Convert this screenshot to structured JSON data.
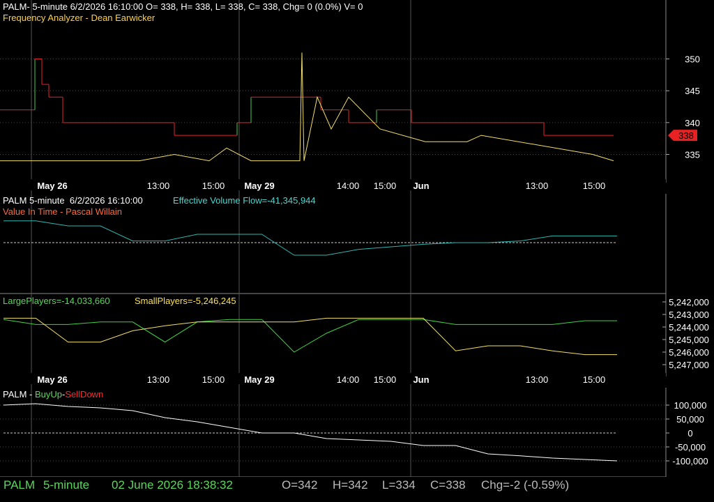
{
  "colors": {
    "green": "#43d143",
    "red": "#e82222",
    "yellow": "#f5e06a",
    "cyan": "#2fb7b0",
    "white": "#ffffff",
    "grid": "#4a4a4a",
    "orange": "#ff6a3d"
  },
  "panel1": {
    "header": "PALM- 5-minute 6/2/2026 16:10:00 O= 338, H= 338, L= 338, C= 338, Chg= 0 (0.0%) V= 0",
    "indicator": "Frequency Analyzer - Dean Earwicker",
    "last_price_tag": "338"
  },
  "panel2": {
    "header": "PALM 5-minute  6/2/2026 16:10:00",
    "flow_label": "Effective Volume Flow=-41,345,944",
    "indicator": "Value In Time - Pascal Willain"
  },
  "panel3": {
    "large_label": "LargePlayers=-14,033,660",
    "small_label": "SmallPlayers=-5,246,245"
  },
  "panel4": {
    "title_prefix": "PALM - ",
    "buy_label": "BuyUp",
    "sep": "-",
    "sell_label": "SellDown"
  },
  "status": {
    "symbol": "PALM",
    "interval": "5-minute",
    "datetime": "02 June 2026 18:38:32",
    "open": "O=342",
    "high": "H=342",
    "low": "L=334",
    "close": "C=338",
    "change": "Chg=-2 (-0.59%)"
  },
  "chart_data": [
    {
      "type": "line",
      "title": "Frequency Analyzer - Dean Earwicker",
      "x_ticks": [
        "May 26",
        "13:00",
        "15:00",
        "May 29",
        "14:00",
        "15:00",
        "Jun",
        "13:00",
        "15:00"
      ],
      "y_ticks": [
        335,
        340,
        345,
        350
      ],
      "ylim": [
        331,
        354
      ],
      "grid": true,
      "series": [
        {
          "color": "red_green",
          "x": [
            0,
            30,
            50,
            60,
            70,
            90,
            120,
            160,
            200,
            250,
            300,
            340,
            360,
            420,
            460,
            500,
            540,
            590,
            640,
            700,
            780,
            880
          ],
          "values": [
            342,
            342,
            350,
            346,
            344,
            340,
            340,
            340,
            340,
            338,
            338,
            340,
            344,
            344,
            342,
            340,
            342,
            340,
            340,
            340,
            338,
            338
          ]
        },
        {
          "color": "yellow",
          "x": [
            0,
            100,
            200,
            250,
            300,
            325,
            360,
            430,
            433,
            436,
            455,
            475,
            500,
            545,
            610,
            670,
            690,
            850,
            880
          ],
          "values": [
            334,
            334,
            334,
            335,
            334,
            336,
            334,
            334,
            351,
            334,
            344,
            339,
            344,
            339,
            337,
            337,
            338,
            335,
            334
          ]
        }
      ]
    },
    {
      "type": "line",
      "title": "Value In Time - Pascal Willain",
      "series": [
        {
          "name": "Effective Volume Flow",
          "values": [
            2.6,
            2.6,
            2.0,
            2.0,
            0.2,
            0.2,
            1.0,
            1.0,
            1.0,
            -1.5,
            -1.5,
            -0.8,
            -0.5,
            -0.2,
            0.0,
            0.0,
            0.2,
            0.8,
            0.8,
            0.8
          ]
        }
      ]
    },
    {
      "type": "line",
      "series": [
        {
          "name": "LargePlayers",
          "values": [
            5243400,
            5243800,
            5243800,
            5243600,
            5243600,
            5245200,
            5243600,
            5243400,
            5243400,
            5246000,
            5244500,
            5243400,
            5243400,
            5243400,
            5243800,
            5243800,
            5243800,
            5243800,
            5243500,
            5243500
          ]
        },
        {
          "name": "SmallPlayers",
          "values": [
            5243300,
            5243300,
            5245200,
            5245200,
            5244300,
            5243900,
            5243600,
            5243600,
            5243600,
            5243600,
            5243300,
            5243300,
            5243300,
            5243300,
            5245900,
            5245500,
            5245500,
            5245900,
            5246200,
            5246200
          ]
        }
      ],
      "y_ticks": [
        "5,242,000",
        "5,243,000",
        "5,244,000",
        "5,245,000",
        "5,246,000",
        "5,247,000"
      ]
    },
    {
      "type": "bar",
      "title": "PALM - BuyUp-SellDown",
      "x_ticks": [
        "May 26",
        "13:00",
        "15:00",
        "May 29",
        "14:00",
        "15:00",
        "Jun",
        "13:00",
        "15:00"
      ],
      "y_ticks": [
        100000,
        50000,
        0,
        -50000,
        -100000
      ],
      "y_tick_labels": [
        "100,000",
        "50,000",
        "0",
        "-50,000",
        "-100,000"
      ],
      "line_values": [
        100000,
        105000,
        95000,
        90000,
        80000,
        55000,
        40000,
        20000,
        0,
        0,
        -20000,
        -25000,
        -30000,
        -45000,
        -45000,
        -75000,
        -82000,
        -90000,
        -95000,
        -100000
      ]
    }
  ]
}
